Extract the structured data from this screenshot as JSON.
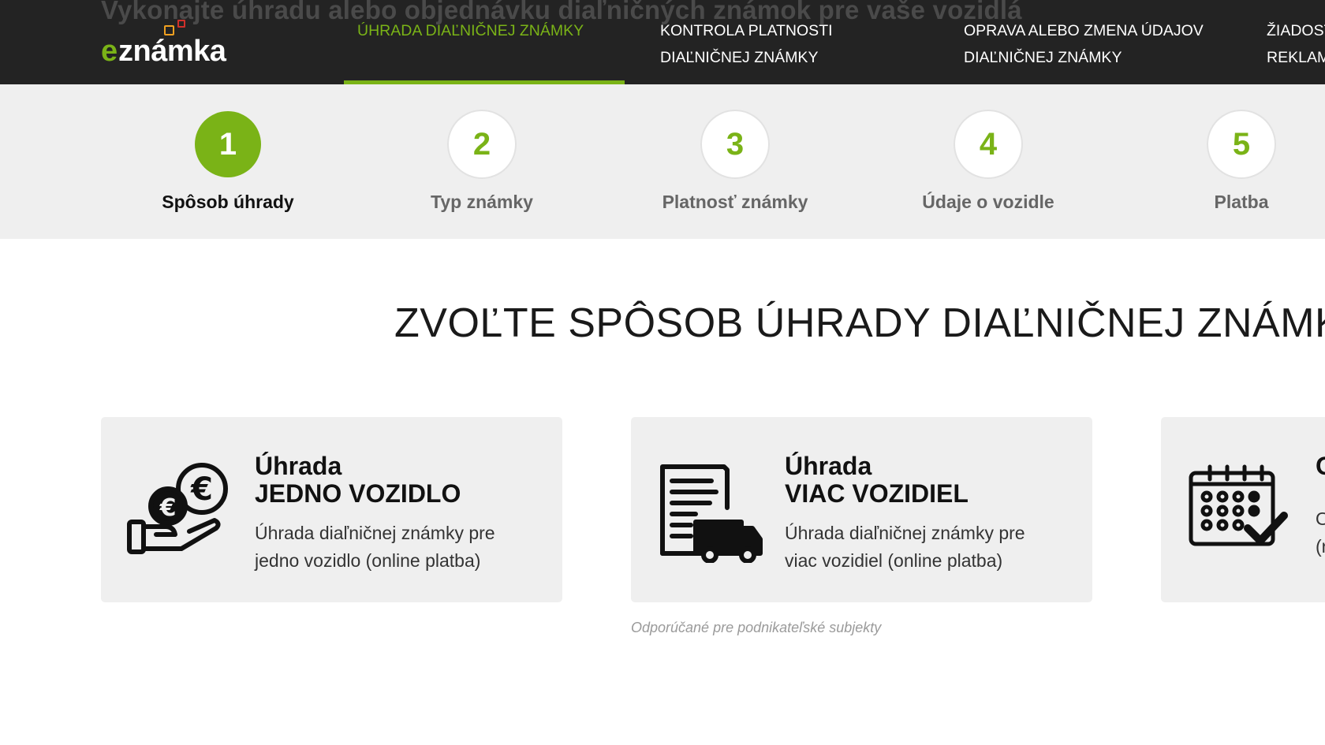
{
  "header": {
    "ghost_text": "Vykonajte úhradu alebo objednávku diaľničných známok pre vaše vozidlá",
    "logo": {
      "prefix": "e",
      "rest": "známka"
    },
    "nav": [
      {
        "line1": "ÚHRADA DIAĽNIČNEJ ZNÁMKY",
        "line2": ""
      },
      {
        "line1": "KONTROLA PLATNOSTI",
        "line2": "DIAĽNIČNEJ ZNÁMKY"
      },
      {
        "line1": "OPRAVA ALEBO ZMENA ÚDAJOV",
        "line2": "DIAĽNIČNEJ ZNÁMKY"
      },
      {
        "line1": "ŽIADOST",
        "line2": "REKLAM"
      }
    ]
  },
  "steps": [
    {
      "number": "1",
      "label": "Spôsob úhrady",
      "active": true
    },
    {
      "number": "2",
      "label": "Typ známky",
      "active": false
    },
    {
      "number": "3",
      "label": "Platnosť známky",
      "active": false
    },
    {
      "number": "4",
      "label": "Údaje o vozidle",
      "active": false
    },
    {
      "number": "5",
      "label": "Platba",
      "active": false
    }
  ],
  "main": {
    "title": "ZVOĽTE SPÔSOB ÚHRADY DIAĽNIČNEJ ZNÁMKY",
    "cards": [
      {
        "icon": "hand-coins-euro-icon",
        "title_line1": "Úhrada",
        "title_line2": "JEDNO VOZIDLO",
        "desc_line1": "Úhrada diaľničnej známky pre",
        "desc_line2": "jedno vozidlo (online platba)"
      },
      {
        "icon": "document-truck-icon",
        "title_line1": "Úhrada",
        "title_line2": "VIAC VOZIDIEL",
        "desc_line1": "Úhrada diaľničnej známky pre",
        "desc_line2": "viac vozidiel (online platba)"
      },
      {
        "icon": "calendar-check-icon",
        "title_line1": "O",
        "title_line2": "",
        "desc_line1": "O",
        "desc_line2": "(r"
      }
    ],
    "note": "Odporúčané pre podnikateľské subjekty"
  },
  "colors": {
    "accent": "#7ab317",
    "header_bg": "#232323",
    "steps_bg": "#efefef",
    "card_bg": "#efefef"
  }
}
